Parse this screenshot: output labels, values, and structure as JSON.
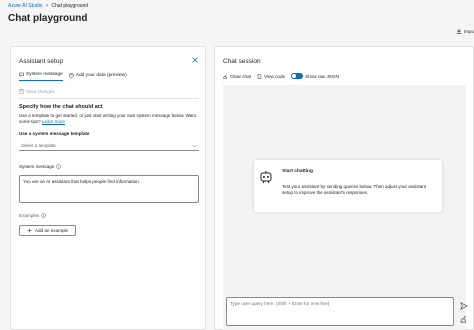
{
  "breadcrumb": {
    "root": "Azure AI Studio",
    "separator": ">",
    "current": "Chat playground"
  },
  "page": {
    "title": "Chat playground",
    "import_label": "Impo"
  },
  "setup": {
    "title": "Assistant setup",
    "tabs": [
      {
        "label": "System message",
        "active": true
      },
      {
        "label": "Add your data (preview)",
        "active": false
      }
    ],
    "save_changes": "Save changes",
    "section_heading": "Specify how the chat should act",
    "desc_text": "Use a template to get started, or just start writing your own system message below. Want some tips? ",
    "desc_link": "Learn more",
    "template_label": "Use a system message template",
    "template_placeholder": "Select a template",
    "system_message_label": "System message",
    "system_message_value": "You are an AI assistant that helps people find information.",
    "examples_label": "Examples",
    "add_example_label": "Add an example"
  },
  "chat": {
    "title": "Chat session",
    "toolbar": {
      "clear_label": "Clear chat",
      "view_code_label": "View code",
      "raw_json_label": "Show raw JSON"
    },
    "start_title": "Start chatting",
    "start_desc": "Test your assistant by sending queries below. Then adjust your assistant setup to improve the assistant's responses.",
    "query_placeholder": "Type user query here. (Shift + Enter for new line)"
  },
  "colors": {
    "accent": "#0f6cbd",
    "panel": "#ffffff",
    "page_bg": "#f5f5f5"
  }
}
